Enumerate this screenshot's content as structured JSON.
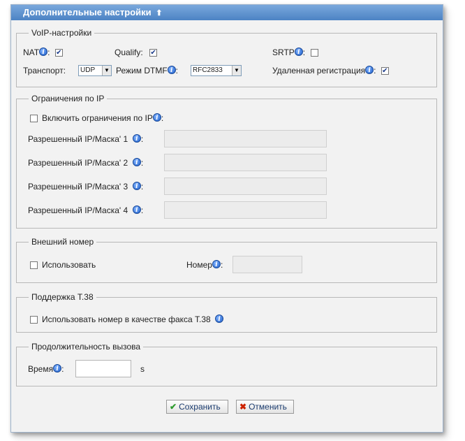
{
  "header": {
    "title": "Дополнительные настройки",
    "collapse_icon": "double-chevron-up-icon"
  },
  "voip": {
    "legend": "VoIP-настройки",
    "nat": {
      "label": "NAT",
      "checked": true
    },
    "qualify": {
      "label": "Qualify:",
      "checked": true
    },
    "srtp": {
      "label": "SRTP",
      "checked": false
    },
    "transport": {
      "label": "Транспорт:",
      "value": "UDP"
    },
    "dtmf": {
      "label": "Режим DTMF",
      "value": "RFC2833"
    },
    "remote_reg": {
      "label": "Удаленная регистрация",
      "checked": true
    }
  },
  "ip": {
    "legend": "Ограничения по IP",
    "enable": {
      "label": "Включить ограничения по IP",
      "checked": false
    },
    "rows": [
      {
        "label": "Разрешенный IP/Маска'",
        "num": "1",
        "value": ""
      },
      {
        "label": "Разрешенный IP/Маска'",
        "num": "2",
        "value": ""
      },
      {
        "label": "Разрешенный IP/Маска'",
        "num": "3",
        "value": ""
      },
      {
        "label": "Разрешенный IP/Маска'",
        "num": "4",
        "value": ""
      }
    ]
  },
  "ext": {
    "legend": "Внешний номер",
    "use": {
      "label": "Использовать",
      "checked": false
    },
    "number": {
      "label": "Номер",
      "value": ""
    }
  },
  "t38": {
    "legend": "Поддержка T.38",
    "use_fax": {
      "label": "Использовать номер в качестве факса T.38",
      "checked": false
    }
  },
  "duration": {
    "legend": "Продолжительность вызова",
    "time": {
      "label": "Время",
      "value": "",
      "unit": "s"
    }
  },
  "buttons": {
    "save": "Сохранить",
    "cancel": "Отменить"
  },
  "symbols": {
    "info": "i",
    "colon": ":",
    "check": "✔",
    "arrow": "▼",
    "chevrons": "≈"
  },
  "colors": {
    "header": "#5b8fcf",
    "save_icon": "#2e9b2e",
    "cancel_icon": "#cc2200"
  }
}
